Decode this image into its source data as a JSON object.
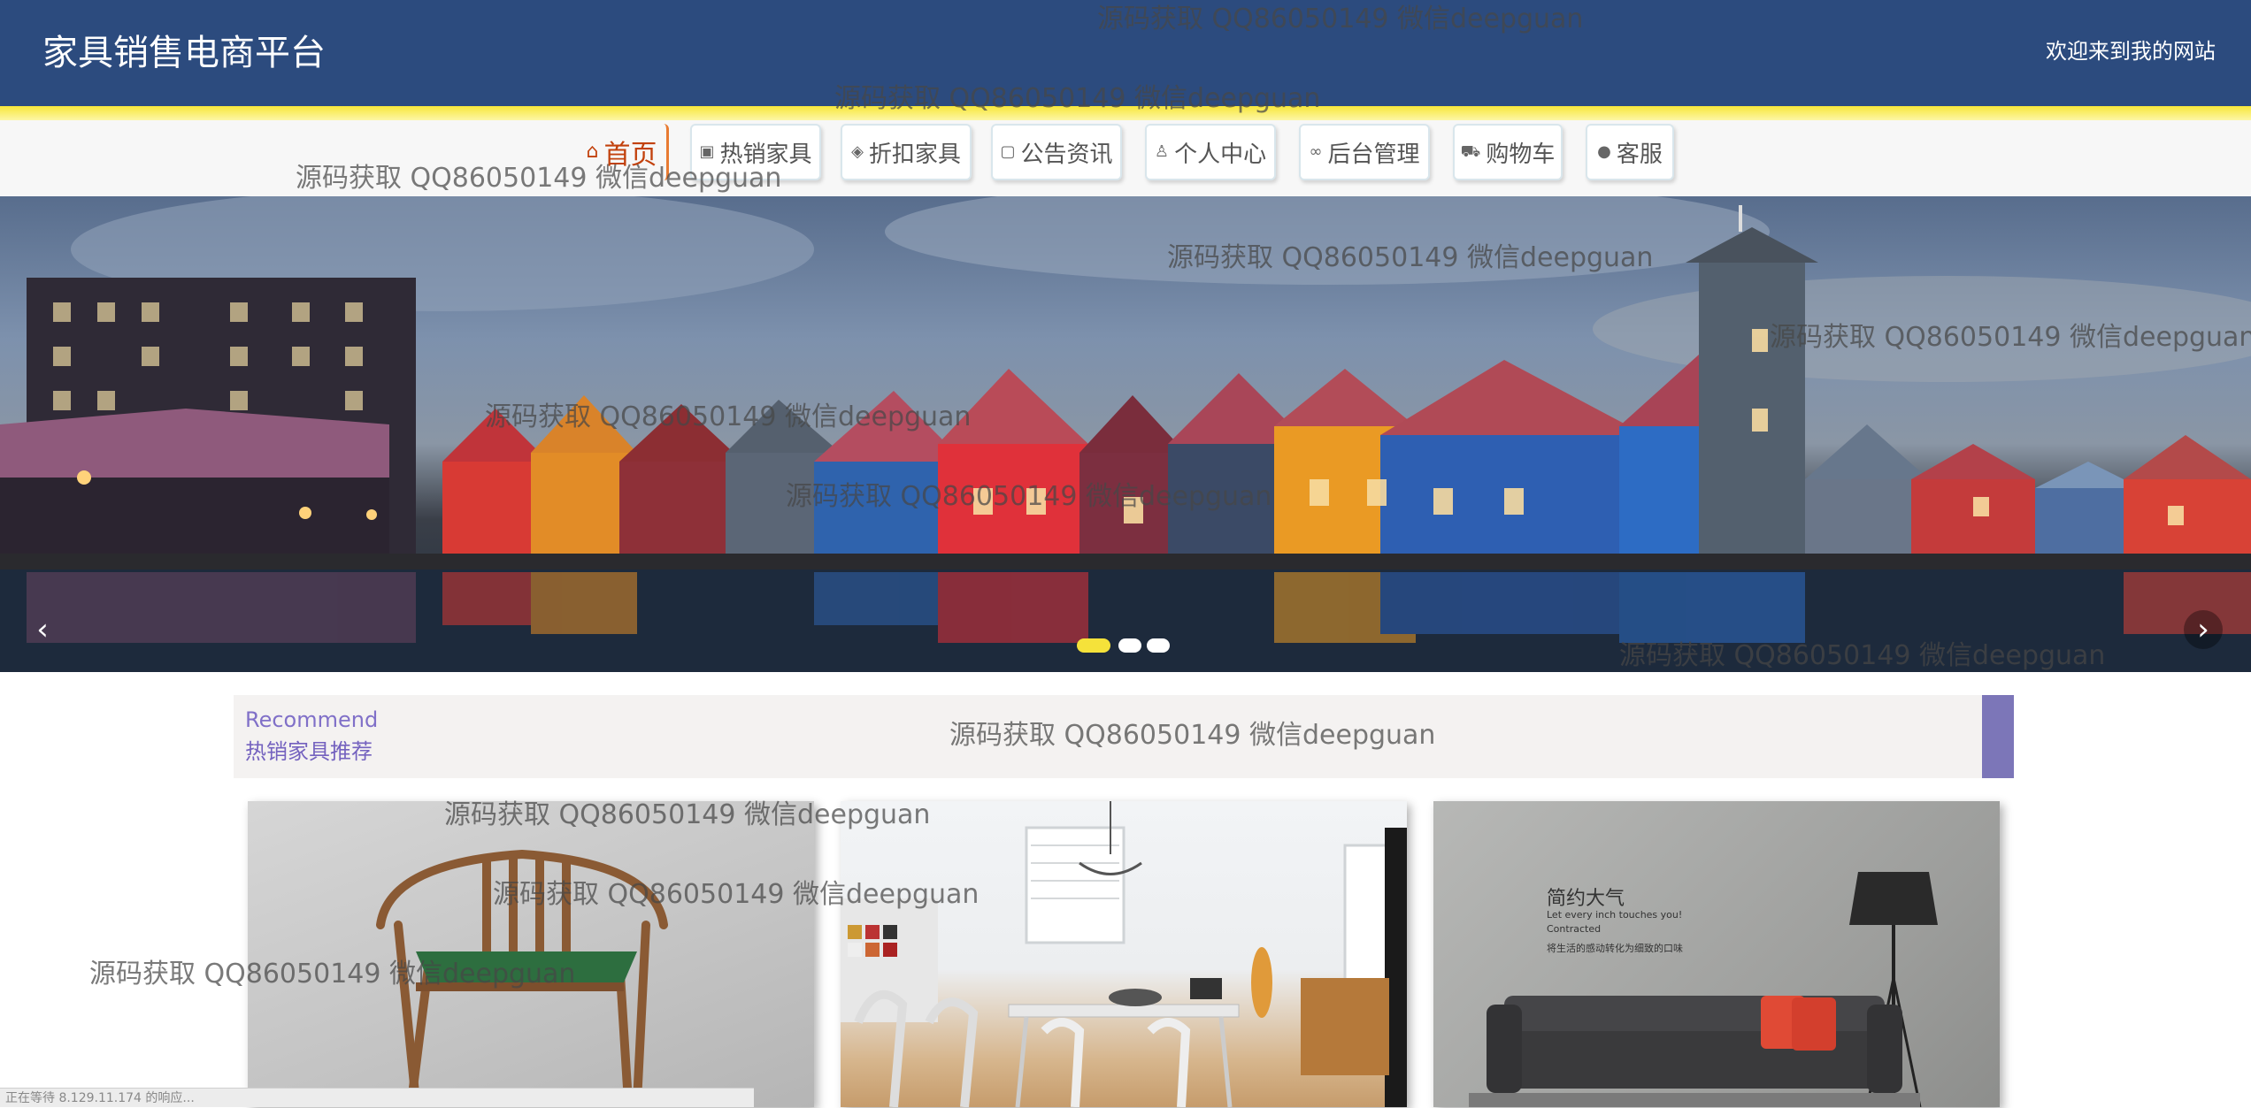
{
  "header": {
    "site_title": "家具销售电商平台",
    "welcome": "欢迎来到我的网站"
  },
  "nav": {
    "items": [
      {
        "label": "首页",
        "icon": "home-icon",
        "active": true
      },
      {
        "label": "热销家具",
        "icon": "fire-icon"
      },
      {
        "label": "折扣家具",
        "icon": "layers-icon"
      },
      {
        "label": "公告资讯",
        "icon": "document-icon"
      },
      {
        "label": "个人中心",
        "icon": "user-icon"
      },
      {
        "label": "后台管理",
        "icon": "link-icon"
      },
      {
        "label": "购物车",
        "icon": "cart-icon"
      },
      {
        "label": "客服",
        "icon": "chat-icon"
      }
    ]
  },
  "banner": {
    "prev_icon": "chevron-left-icon",
    "next_icon": "chevron-right-icon",
    "slide_count": 3,
    "active_slide": 1,
    "colors": {
      "active_dot": "#f5e23a",
      "dot": "#ffffff"
    }
  },
  "recommend": {
    "en": "Recommend",
    "cn": "热销家具推荐"
  },
  "products": [
    {
      "image": "wooden-chair-photo"
    },
    {
      "image": "dining-room-photo"
    },
    {
      "image": "sofa-lamp-photo",
      "photo_text": {
        "line1": "简约大气",
        "line2": "Let every inch touches you!",
        "line3": "Contracted",
        "line4": "将生活的感动转化为细致的口味"
      }
    }
  ],
  "watermark": "源码获取 QQ86050149 微信deepguan",
  "status_bar": "正在等待 8.129.11.174 的响应...",
  "colors": {
    "header_bg": "#2c4b7e",
    "accent_yellow": "#f7e73a",
    "recommend_purple": "#7c76b8",
    "active_nav": "#c2410c"
  }
}
